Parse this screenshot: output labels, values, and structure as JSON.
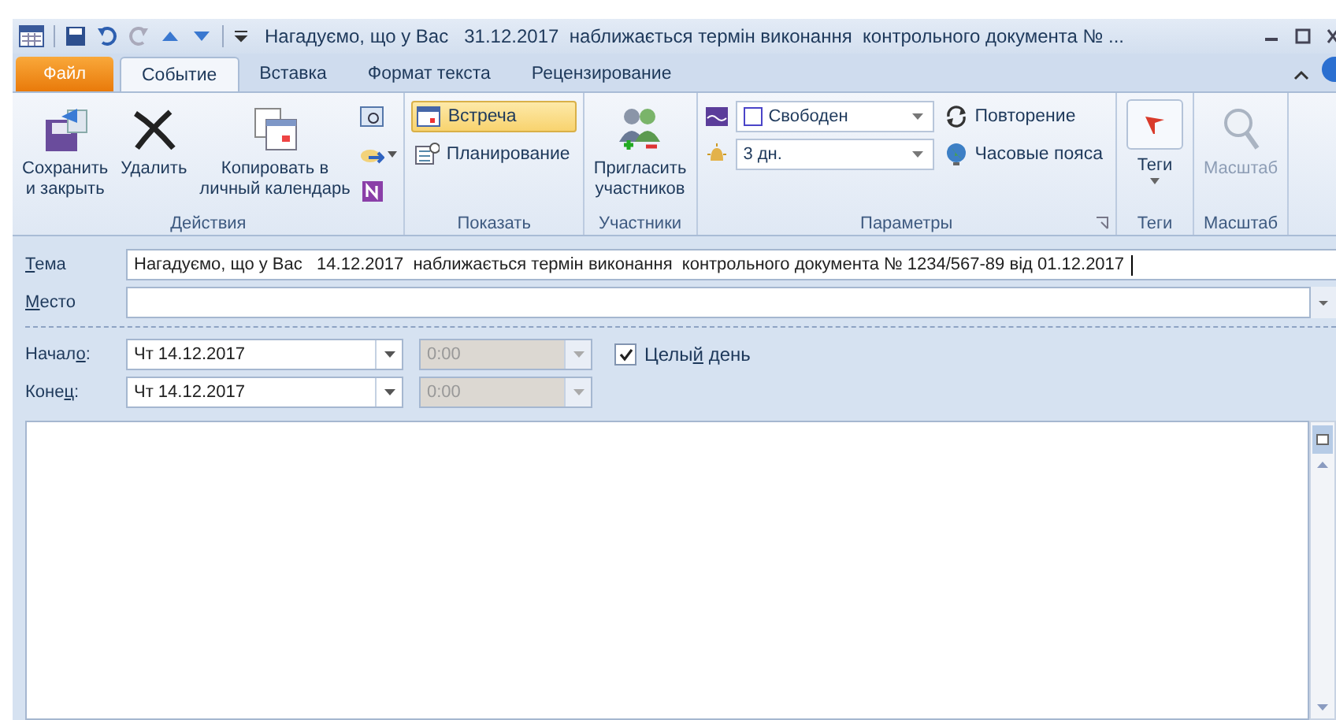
{
  "window": {
    "title": "Нагадуємо, що у Вас   31.12.2017  наближається термін виконання  контрольного документа № ..."
  },
  "tabs": [
    {
      "label": "Файл",
      "kind": "file",
      "selected": false
    },
    {
      "label": "Событие",
      "kind": "tab",
      "selected": true
    },
    {
      "label": "Вставка",
      "kind": "tab",
      "selected": false
    },
    {
      "label": "Формат текста",
      "kind": "tab",
      "selected": false
    },
    {
      "label": "Рецензирование",
      "kind": "tab",
      "selected": false
    }
  ],
  "ribbon": {
    "groups": [
      {
        "label": "Действия",
        "items": [
          {
            "kind": "large",
            "lines": [
              "Сохранить",
              "и закрыть"
            ]
          },
          {
            "kind": "large",
            "lines": [
              "Удалить"
            ]
          },
          {
            "kind": "large",
            "lines": [
              "Копировать в",
              "личный календарь"
            ]
          },
          {
            "kind": "column",
            "items": [
              {
                "kind": "icon"
              },
              {
                "kind": "icon",
                "caret": true
              },
              {
                "kind": "icon"
              }
            ]
          }
        ]
      },
      {
        "label": "Показать",
        "items": [
          {
            "kind": "column",
            "items": [
              {
                "kind": "toggle",
                "label": "Встреча",
                "selected": true
              },
              {
                "kind": "toggle",
                "label": "Планирование",
                "selected": false
              }
            ]
          }
        ]
      },
      {
        "label": "Участники",
        "items": [
          {
            "kind": "large",
            "lines": [
              "Пригласить",
              "участников"
            ]
          }
        ]
      },
      {
        "label": "Параметры",
        "launcher": true,
        "items": [
          {
            "kind": "column",
            "items": [
              {
                "kind": "icon"
              },
              {
                "kind": "icon"
              }
            ]
          },
          {
            "kind": "column",
            "items": [
              {
                "kind": "dropdown",
                "swatch": true,
                "value": "Свободен"
              },
              {
                "kind": "dropdown",
                "value": "3 дн."
              }
            ]
          },
          {
            "kind": "column",
            "items": [
              {
                "kind": "small",
                "label": "Повторение"
              },
              {
                "kind": "small",
                "label": "Часовые пояса"
              }
            ]
          }
        ]
      },
      {
        "label": "Теги",
        "items": [
          {
            "kind": "large",
            "lines": [
              "Теги"
            ],
            "caret": true
          }
        ]
      },
      {
        "label": "Масштаб",
        "items": [
          {
            "kind": "large",
            "lines": [
              "Масштаб"
            ],
            "disabled": true
          }
        ]
      }
    ]
  },
  "form": {
    "subject": {
      "access_key": "Т",
      "label_after": "ема",
      "value": "Нагадуємо, що у Вас   14.12.2017  наближається термін виконання  контрольного документа № 1234/567-89 від 01.12.2017"
    },
    "location": {
      "access_key": "М",
      "label_after": "есто"
    },
    "start": {
      "label_before": "Начал",
      "access_key": "о",
      "label_after": ":",
      "date": "Чт 14.12.2017",
      "time": "0:00",
      "time_disabled": true
    },
    "end": {
      "label_before": "Коне",
      "access_key": "ц",
      "label_after": ":",
      "date": "Чт 14.12.2017",
      "time": "0:00",
      "time_disabled": true
    },
    "all_day": {
      "label_before": "Целы",
      "access_key": "й",
      "label_after": " день",
      "checked": true
    }
  }
}
